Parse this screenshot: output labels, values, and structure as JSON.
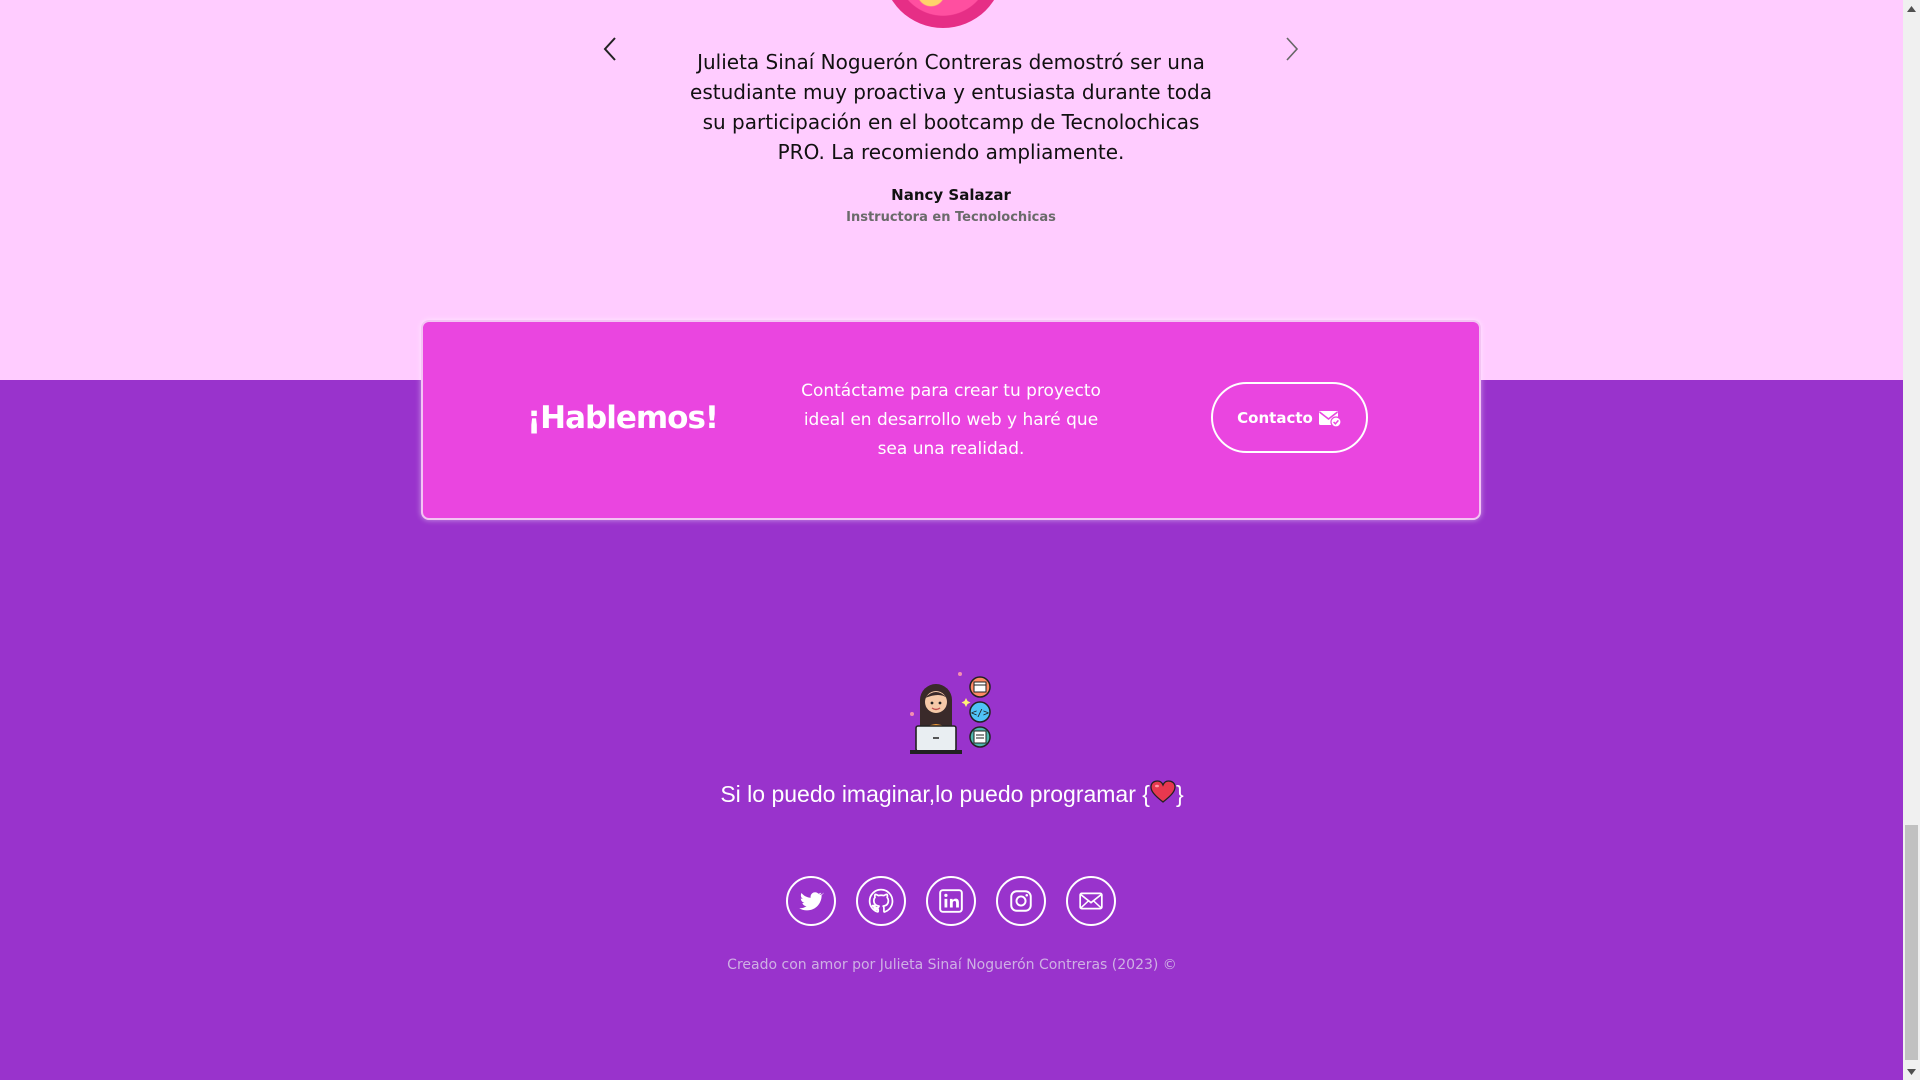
{
  "testimonial": {
    "quote": "Julieta Sinaí Noguerón Contreras demostró ser una estudiante muy proactiva y entusiasta durante toda su participación en el bootcamp de Tecnolochicas PRO. La recomiendo ampliamente.",
    "author": "Nancy Salazar",
    "role": "Instructora en Tecnolochicas",
    "prev_icon": "chevron-left-icon",
    "next_icon": "chevron-right-icon"
  },
  "cta": {
    "title": "¡Hablemos!",
    "text": "Contáctame para crear tu proyecto ideal en desarrollo web y haré que sea una realidad.",
    "button_label": "Contacto",
    "button_icon": "mail-check-icon"
  },
  "footer": {
    "tagline_prefix": "Si lo puedo imaginar,lo puedo programar {",
    "tagline_suffix": "}",
    "credit": "Creado con amor por Julieta Sinaí Noguerón Contreras (2023) ©",
    "social": [
      "twitter-icon",
      "github-icon",
      "linkedin-icon",
      "instagram-icon",
      "mail-icon"
    ]
  },
  "colors": {
    "testimonial_bg": "#ffccff",
    "footer_bg": "#9933cc",
    "cta_bg": "#ea45e0"
  }
}
